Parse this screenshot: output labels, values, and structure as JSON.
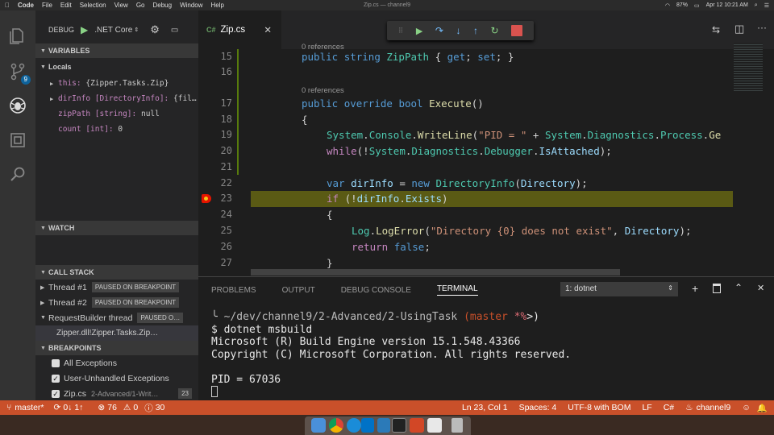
{
  "menubar": {
    "apple": "",
    "app": "Code",
    "items": [
      "File",
      "Edit",
      "Selection",
      "View",
      "Go",
      "Debug",
      "Window",
      "Help"
    ],
    "window_title": "Zip.cs — channel9",
    "battery": "87%",
    "clock": "Apr 12  10:21 AM"
  },
  "activity": {
    "scm_badge": "9"
  },
  "debug": {
    "label": "DEBUG",
    "config": ".NET Core"
  },
  "variables": {
    "header": "VARIABLES",
    "locals_label": "Locals",
    "rows": [
      {
        "name": "this:",
        "value": "{Zipper.Tasks.Zip}",
        "expandable": true
      },
      {
        "name": "dirInfo [DirectoryInfo]:",
        "value": "{fil…",
        "expandable": true
      },
      {
        "name": "zipPath [string]:",
        "value": "null",
        "expandable": false
      },
      {
        "name": "count [int]:",
        "value": "0",
        "expandable": false
      }
    ]
  },
  "watch": {
    "header": "WATCH"
  },
  "callstack": {
    "header": "CALL STACK",
    "rows": [
      {
        "name": "Thread #1",
        "badge": "PAUSED ON BREAKPOINT"
      },
      {
        "name": "Thread #2",
        "badge": "PAUSED ON BREAKPOINT"
      },
      {
        "name": "RequestBuilder thread",
        "badge": "PAUSED O…"
      }
    ],
    "frame": "Zipper.dll!Zipper.Tasks.Zip…"
  },
  "breakpoints": {
    "header": "BREAKPOINTS",
    "rows": [
      {
        "label": "All Exceptions",
        "checked": false,
        "detail": "",
        "count": ""
      },
      {
        "label": "User-Unhandled Exceptions",
        "checked": true,
        "detail": "",
        "count": ""
      },
      {
        "label": "Zip.cs",
        "checked": true,
        "detail": "2-Advanced/1-Writ…",
        "count": "23"
      }
    ]
  },
  "editor": {
    "tab": "Zip.cs",
    "tab_icon": "C#",
    "top_refs": "0 references",
    "refs": "0 references",
    "lines": [
      "15",
      "16",
      "17",
      "18",
      "19",
      "20",
      "21",
      "22",
      "23",
      "24",
      "25",
      "26",
      "27"
    ]
  },
  "panel": {
    "tabs": [
      "PROBLEMS",
      "OUTPUT",
      "DEBUG CONSOLE",
      "TERMINAL"
    ],
    "terminal_select": "1: dotnet"
  },
  "terminal": {
    "prompt_path": "~/dev/channel9/2-Advanced/2-UsingTask",
    "branch": "master",
    "dirty": "*%",
    "command": "$ dotnet msbuild",
    "output": [
      "Microsoft (R) Build Engine version 15.1.548.43366",
      "Copyright (C) Microsoft Corporation. All rights reserved.",
      "",
      "PID = 67036"
    ]
  },
  "status": {
    "branch": "master*",
    "sync": "0↓ 1↑",
    "errors": "76",
    "warnings": "0",
    "infos": "30",
    "position": "Ln 23, Col 1",
    "spaces": "Spaces: 4",
    "encoding": "UTF-8 with BOM",
    "eol": "LF",
    "language": "C#",
    "project": "channel9"
  },
  "colors": {
    "statusbar": "#c9502a",
    "breakpoint": "#e51400",
    "current_line": "#5a5a14",
    "activity": "#333333"
  }
}
